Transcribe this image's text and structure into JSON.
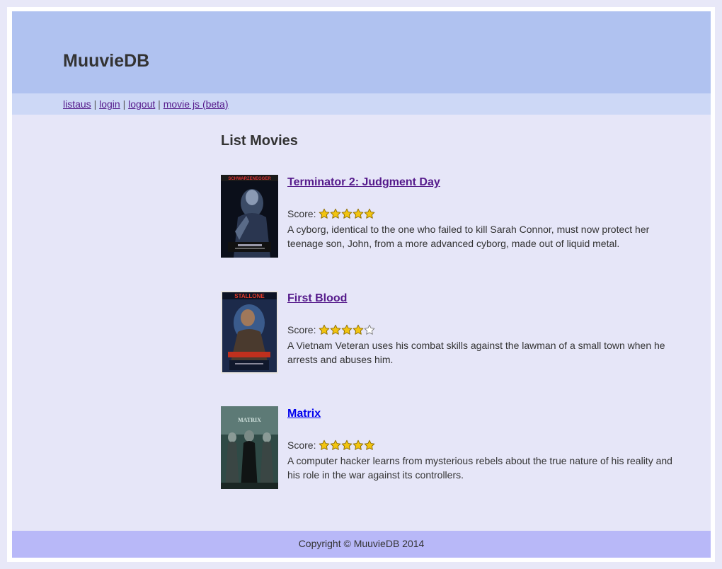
{
  "site": {
    "title": "MuuvieDB"
  },
  "nav": {
    "links": [
      "listaus",
      "login",
      "logout",
      "movie js (beta)"
    ],
    "separator": "|"
  },
  "main": {
    "heading": "List Movies",
    "score_label": "Score:"
  },
  "movies": [
    {
      "title": "Terminator 2: Judgment Day",
      "rating": 5,
      "max_rating": 5,
      "description": "A cyborg, identical to the one who failed to kill Sarah Connor, must now protect her teenage son, John, from a more advanced cyborg, made out of liquid metal.",
      "link_state": "visited",
      "poster_text": "SCHWARZENEGGER"
    },
    {
      "title": "First Blood",
      "rating": 4,
      "max_rating": 5,
      "description": "A Vietnam Veteran uses his combat skills against the lawman of a small town when he arrests and abuses him.",
      "link_state": "visited",
      "poster_text": "STALLONE"
    },
    {
      "title": "Matrix",
      "rating": 5,
      "max_rating": 5,
      "description": "A computer hacker learns from mysterious rebels about the true nature of his reality and his role in the war against its controllers.",
      "link_state": "unvisited",
      "poster_text": "MATRIX"
    }
  ],
  "footer": {
    "text": "Copyright © MuuvieDB 2014"
  },
  "colors": {
    "header_bg": "#b0c2f0",
    "nav_bg": "#cdd8f6",
    "page_bg": "#e6e6f8",
    "footer_bg": "#b8b8f8",
    "star_fill": "#f2c40f",
    "visited_link": "#551a8b",
    "link": "#0000ee"
  }
}
